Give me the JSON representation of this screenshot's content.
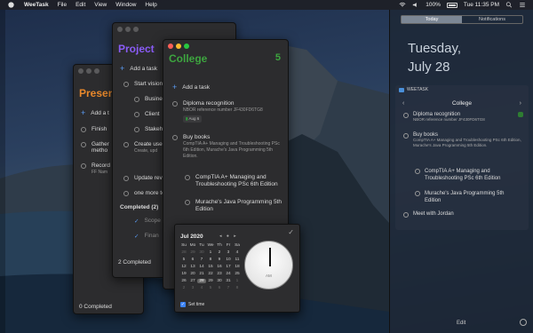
{
  "menubar": {
    "app_name": "WeeTask",
    "menus": [
      "File",
      "Edit",
      "View",
      "Window",
      "Help"
    ],
    "battery": "100%",
    "clock": "Tue 11:35 PM"
  },
  "presentation_window": {
    "title": "Present",
    "add_task": "Add a t",
    "items": [
      "Finish",
      "Gather",
      "metho",
      "Record",
      "FF Nam"
    ],
    "footer": "0 Completed"
  },
  "project_window": {
    "title": "Project",
    "add_task": "Add a task",
    "items": [
      "Start vision",
      "Busine",
      "Client",
      "Stakeh",
      "Create use",
      "Create, upd",
      "Update revi",
      "one more to"
    ],
    "completed_header": "Completed (2)",
    "completed_items": [
      "Scope",
      "Finan"
    ],
    "footer": "2 Completed"
  },
  "college_window": {
    "title": "College",
    "count": "5",
    "add_task": "Add a task",
    "tasks": [
      {
        "title": "Diploma recognition",
        "note": "NBOR reference number JF430FD6TG8",
        "tag": "Aug 6"
      },
      {
        "title": "Buy books",
        "note": "CompTIA A+ Managing and Troubleshooting PSc 6th Edition, Murache's Java Programming 5th Edition."
      }
    ],
    "subtasks": [
      "CompTIA A+ Managing and Troubleshooting PSc 6th Edition",
      "Murache's Java Programming 5th Edition"
    ]
  },
  "date_picker": {
    "month": "Jul 2020",
    "weekdays": [
      "Su",
      "Mo",
      "Tu",
      "We",
      "Th",
      "Fr",
      "Sa"
    ],
    "days": [
      "28",
      "29",
      "30",
      "1",
      "2",
      "3",
      "4",
      "5",
      "6",
      "7",
      "8",
      "9",
      "10",
      "11",
      "12",
      "13",
      "14",
      "15",
      "16",
      "17",
      "18",
      "19",
      "20",
      "21",
      "22",
      "23",
      "24",
      "25",
      "26",
      "27",
      "28",
      "29",
      "30",
      "31",
      "1",
      "2",
      "3",
      "4",
      "5",
      "6",
      "7",
      "8"
    ],
    "selected_day": "28",
    "clock_am": "AM",
    "set_time_label": "Set time"
  },
  "notification_center": {
    "tabs": [
      "Today",
      "Notifications"
    ],
    "weekday": "Tuesday,",
    "date": "July 28",
    "widget": {
      "app": "WEETASK",
      "list_title": "College",
      "items": [
        {
          "title": "Diploma recognition",
          "note": "NBOR reference number JF430FD6TG8"
        },
        {
          "title": "Buy books",
          "note": "CompTIA A+ Managing and Troubleshooting PSc 6th Edition, Murache's Java Programming 5th Edition."
        }
      ],
      "subitems": [
        "CompTIA A+ Managing and Troubleshooting PSc 6th Edition",
        "Murache's Java Programming 5th Edition"
      ],
      "last_item": "Meet with Jordan"
    },
    "edit_label": "Edit"
  },
  "colors": {
    "college_green": "#3da53f",
    "project_purple": "#8a5cf6",
    "presentation_orange": "#e8882b",
    "accent_blue": "#5b9cf5"
  }
}
